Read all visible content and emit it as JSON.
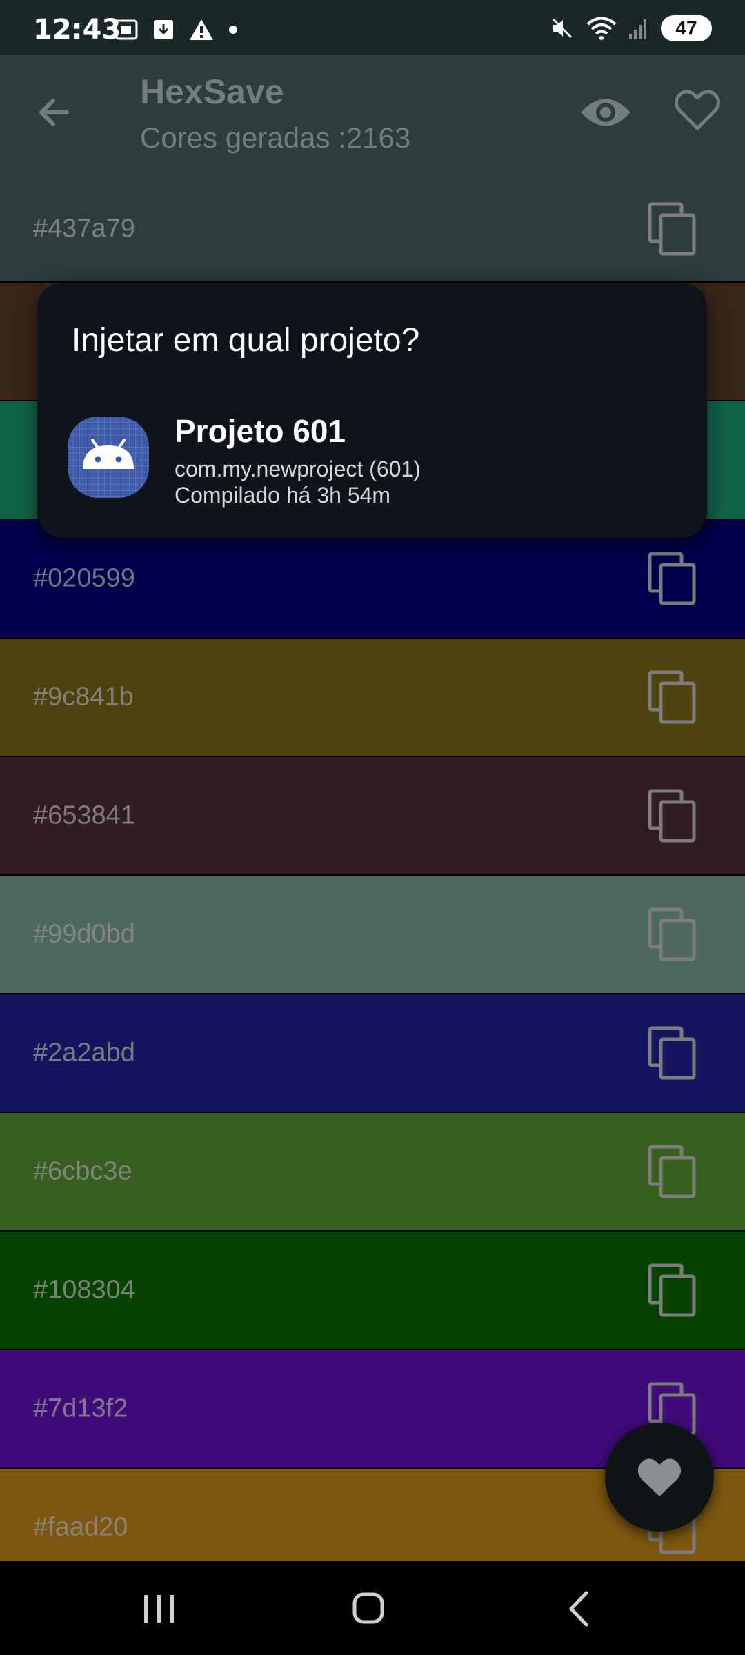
{
  "status_bar": {
    "time": "12:43",
    "battery": "47"
  },
  "app_bar": {
    "title": "HexSave",
    "subtitle": "Cores geradas :2163"
  },
  "colors": [
    {
      "hex": "#437a79",
      "bg": "#2c3d3c"
    },
    {
      "hex": "",
      "bg": "#3a2619"
    },
    {
      "hex": "",
      "bg": "#10644a"
    },
    {
      "hex": "#020599",
      "bg": "#00004d"
    },
    {
      "hex": "#9c841b",
      "bg": "#4e420e"
    },
    {
      "hex": "#653841",
      "bg": "#321c21"
    },
    {
      "hex": "#99d0bd",
      "bg": "#4d685f"
    },
    {
      "hex": "#2a2abd",
      "bg": "#15155f"
    },
    {
      "hex": "#6cbc3e",
      "bg": "#365e1f"
    },
    {
      "hex": "#108304",
      "bg": "#084202"
    },
    {
      "hex": "#7d13f2",
      "bg": "#3f0a79"
    },
    {
      "hex": "#faad20",
      "bg": "#7d5710"
    }
  ],
  "dialog": {
    "title": "Injetar em qual projeto?",
    "project": {
      "name": "Projeto 601",
      "package": "com.my.newproject (601)",
      "compiled": "Compilado há 3h 54m",
      "icon": "android-icon"
    }
  },
  "icons": {
    "back": "arrow-left-icon",
    "eye": "eye-icon",
    "favorite": "heart-outline-icon",
    "copy": "copy-icon",
    "fab": "heart-icon"
  },
  "accent_colors": {
    "app_bar": "#2c3d3c",
    "dialog": "#0f131a",
    "fab": "#101417"
  }
}
